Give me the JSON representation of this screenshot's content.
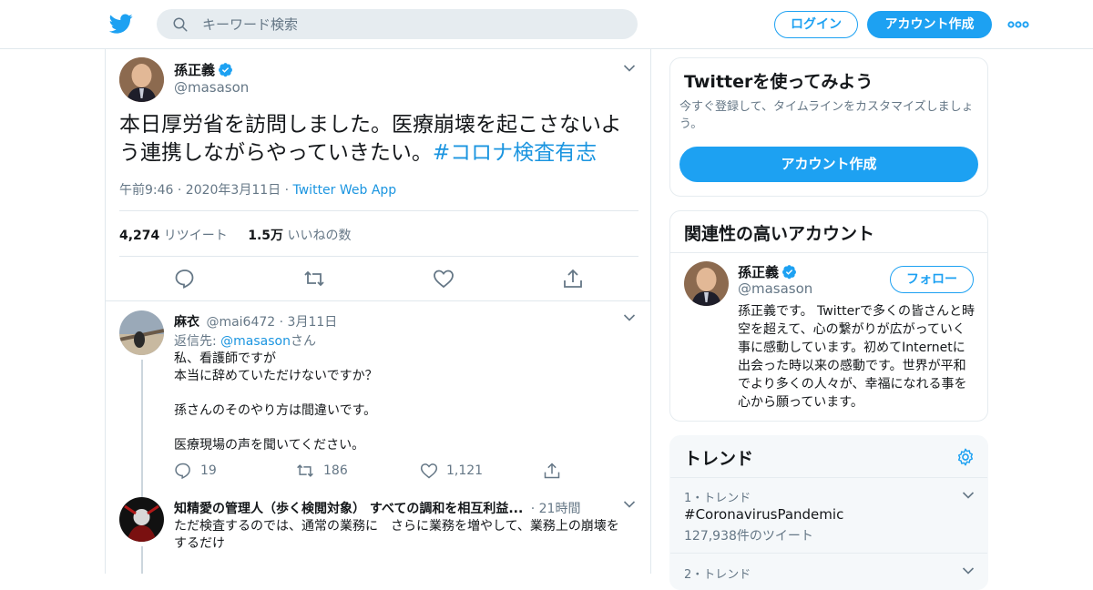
{
  "topbar": {
    "search_placeholder": "キーワード検索",
    "login": "ログイン",
    "signup": "アカウント作成"
  },
  "tweet": {
    "name": "孫正義",
    "handle": "@masason",
    "text": "本日厚労省を訪問しました。医療崩壊を起こさないよう連携しながらやっていきたい。",
    "hashtag": "#コロナ検査有志",
    "time": "午前9:46 · 2020年3月11日 · ",
    "source": "Twitter Web App",
    "retweets": "4,274",
    "retweets_label": "リツイート",
    "likes": "1.5万",
    "likes_label": "いいねの数"
  },
  "reply1": {
    "name": "麻衣",
    "meta": "@mai6472 · 3月11日",
    "reply_prefix": "返信先: ",
    "reply_to": "@masason",
    "reply_suffix": "さん",
    "lines": [
      "私、看護師ですが",
      "本当に辞めていただけないですか？",
      "",
      "孫さんのそのやり方は間違いです。",
      "",
      "医療現場の声を聞いてください。"
    ],
    "replies": "19",
    "retweets": "186",
    "likes": "1,121"
  },
  "reply2": {
    "name": "知精愛の管理人（歩く検閲対象） すべての調和を相互利益...",
    "meta": "· 21時間",
    "text": "ただ検査するのでは、通常の業務に　さらに業務を増やして、業務上の崩壊をするだけ"
  },
  "signup_card": {
    "title": "Twitterを使ってみよう",
    "desc": "今すぐ登録して、タイムラインをカスタマイズしましょう。",
    "button": "アカウント作成"
  },
  "related": {
    "title": "関連性の高いアカウント",
    "name": "孫正義",
    "handle": "@masason",
    "follow": "フォロー",
    "bio": "孫正義です。 Twitterで多くの皆さんと時空を超えて、心の繋がりが広がっていく事に感動しています。初めてInternetに出会った時以来の感動です。世界が平和でより多くの人々が、幸福になれる事を心から願っています。"
  },
  "trends": {
    "title": "トレンド",
    "items": [
      {
        "meta": "1・トレンド",
        "name": "#CoronavirusPandemic",
        "count": "127,938件のツイート"
      },
      {
        "meta": "2・トレンド",
        "name": "",
        "count": ""
      }
    ]
  },
  "colors": {
    "accent": "#1da1f2",
    "link": "#1b95e0",
    "muted": "#657786"
  }
}
